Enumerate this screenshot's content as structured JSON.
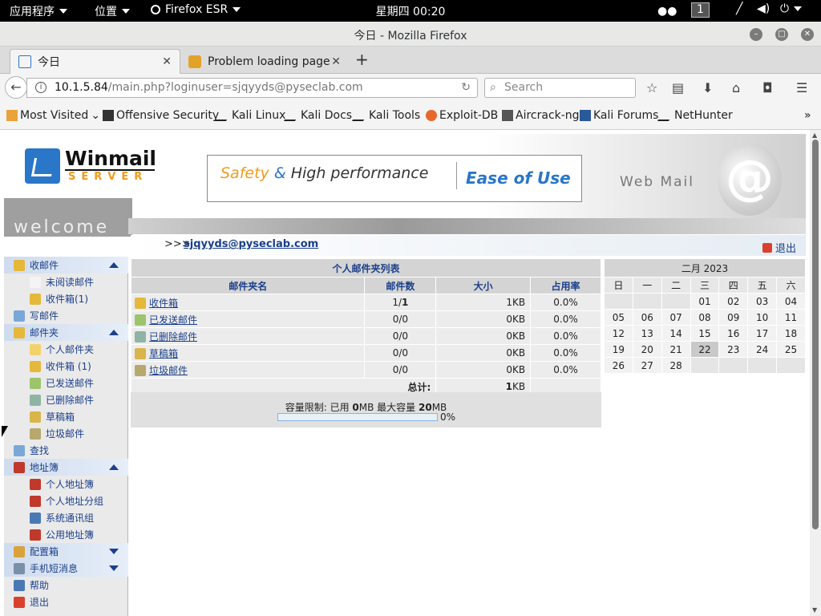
{
  "system_bar": {
    "apps_menu": "应用程序",
    "places_menu": "位置",
    "browser_menu": "Firefox ESR",
    "clock": "星期四 00:20",
    "workspace": "1"
  },
  "window": {
    "title": "今日 - Mozilla Firefox"
  },
  "tabs": [
    {
      "label": "今日"
    },
    {
      "label": "Problem loading page"
    }
  ],
  "nav": {
    "url_host": "10.1.5.84",
    "url_path": "/main.php?loginuser=sjqyyds@pyseclab.com",
    "search_placeholder": "Search"
  },
  "bookmarks": [
    {
      "label": "Most Visited"
    },
    {
      "label": "Offensive Security"
    },
    {
      "label": "Kali Linux"
    },
    {
      "label": "Kali Docs"
    },
    {
      "label": "Kali Tools"
    },
    {
      "label": "Exploit-DB"
    },
    {
      "label": "Aircrack-ng"
    },
    {
      "label": "Kali Forums"
    },
    {
      "label": "NetHunter"
    }
  ],
  "header": {
    "logo_text": "Winmail",
    "logo_sub": "SERVER",
    "banner_safety": "Safety",
    "banner_amp": "&",
    "banner_high": "High performance",
    "banner_ease": "Ease of Use",
    "webmail": "Web Mail",
    "welcome": "welcome"
  },
  "user": {
    "prefix": ">>>",
    "email": "sjqyyds@pyseclab.com",
    "logout": "退出"
  },
  "sidebar": [
    {
      "label": "收邮件",
      "level": 1,
      "cat": true,
      "arrow": "up",
      "color": "#e5b83a"
    },
    {
      "label": "未阅读邮件",
      "level": 2,
      "color": "#f4f4f4"
    },
    {
      "label": "收件箱(1)",
      "level": 2,
      "color": "#e5b83a"
    },
    {
      "label": "写邮件",
      "level": 1,
      "color": "#7aa7d8"
    },
    {
      "label": "邮件夹",
      "level": 1,
      "cat": true,
      "arrow": "up",
      "color": "#e5b83a"
    },
    {
      "label": "个人邮件夹",
      "level": 2,
      "color": "#f2d36b"
    },
    {
      "label": "收件箱 (1)",
      "level": 2,
      "color": "#e5b83a"
    },
    {
      "label": "已发送邮件",
      "level": 2,
      "color": "#9bc46b"
    },
    {
      "label": "已删除邮件",
      "level": 2,
      "color": "#8fb3a4"
    },
    {
      "label": "草稿箱",
      "level": 2,
      "color": "#d9b54a"
    },
    {
      "label": "垃圾邮件",
      "level": 2,
      "color": "#b7a86b"
    },
    {
      "label": "查找",
      "level": 1,
      "color": "#7aa7d8"
    },
    {
      "label": "地址簿",
      "level": 1,
      "cat": true,
      "arrow": "up",
      "color": "#c0392b"
    },
    {
      "label": "个人地址簿",
      "level": 2,
      "color": "#c0392b"
    },
    {
      "label": "个人地址分组",
      "level": 2,
      "color": "#c0392b"
    },
    {
      "label": "系统通讯组",
      "level": 2,
      "color": "#4a78b5"
    },
    {
      "label": "公用地址簿",
      "level": 2,
      "color": "#c0392b"
    },
    {
      "label": "配置箱",
      "level": 1,
      "cat": true,
      "arrow": "down",
      "color": "#d9a23a"
    },
    {
      "label": "手机短消息",
      "level": 1,
      "cat": true,
      "arrow": "down",
      "color": "#7a8fa8"
    },
    {
      "label": "帮助",
      "level": 1,
      "color": "#4a78b5"
    },
    {
      "label": "退出",
      "level": 1,
      "color": "#d9412e"
    }
  ],
  "folders": {
    "caption": "个人邮件夹列表",
    "headers": [
      "邮件夹名",
      "邮件数",
      "大小",
      "占用率"
    ],
    "rows": [
      {
        "name": "收件箱",
        "count_total": "1/",
        "count_unread": "1",
        "size": "1KB",
        "usage": "0.0%",
        "color": "#e5b83a"
      },
      {
        "name": "已发送邮件",
        "count_total": "0/0",
        "count_unread": "",
        "size": "0KB",
        "usage": "0.0%",
        "color": "#9bc46b"
      },
      {
        "name": "已删除邮件",
        "count_total": "0/0",
        "count_unread": "",
        "size": "0KB",
        "usage": "0.0%",
        "color": "#8fb3a4"
      },
      {
        "name": "草稿箱",
        "count_total": "0/0",
        "count_unread": "",
        "size": "0KB",
        "usage": "0.0%",
        "color": "#d9b54a"
      },
      {
        "name": "垃圾邮件",
        "count_total": "0/0",
        "count_unread": "",
        "size": "0KB",
        "usage": "0.0%",
        "color": "#b7a86b"
      }
    ],
    "total_label": "总计:",
    "total_size_num": "1",
    "total_size_unit": "KB"
  },
  "quota": {
    "label_prefix": "容量限制: 已用 ",
    "used_num": "0",
    "label_mid": "MB 最大容量 ",
    "max_num": "20",
    "label_suffix": "MB",
    "percent": "0%"
  },
  "calendar": {
    "title": "二月 2023",
    "weekdays": [
      "日",
      "一",
      "二",
      "三",
      "四",
      "五",
      "六"
    ],
    "weeks": [
      [
        "",
        "",
        "",
        "01",
        "02",
        "03",
        "04"
      ],
      [
        "05",
        "06",
        "07",
        "08",
        "09",
        "10",
        "11"
      ],
      [
        "12",
        "13",
        "14",
        "15",
        "16",
        "17",
        "18"
      ],
      [
        "19",
        "20",
        "21",
        "22",
        "23",
        "24",
        "25"
      ],
      [
        "26",
        "27",
        "28",
        "",
        "",
        "",
        ""
      ]
    ],
    "today": "22"
  }
}
